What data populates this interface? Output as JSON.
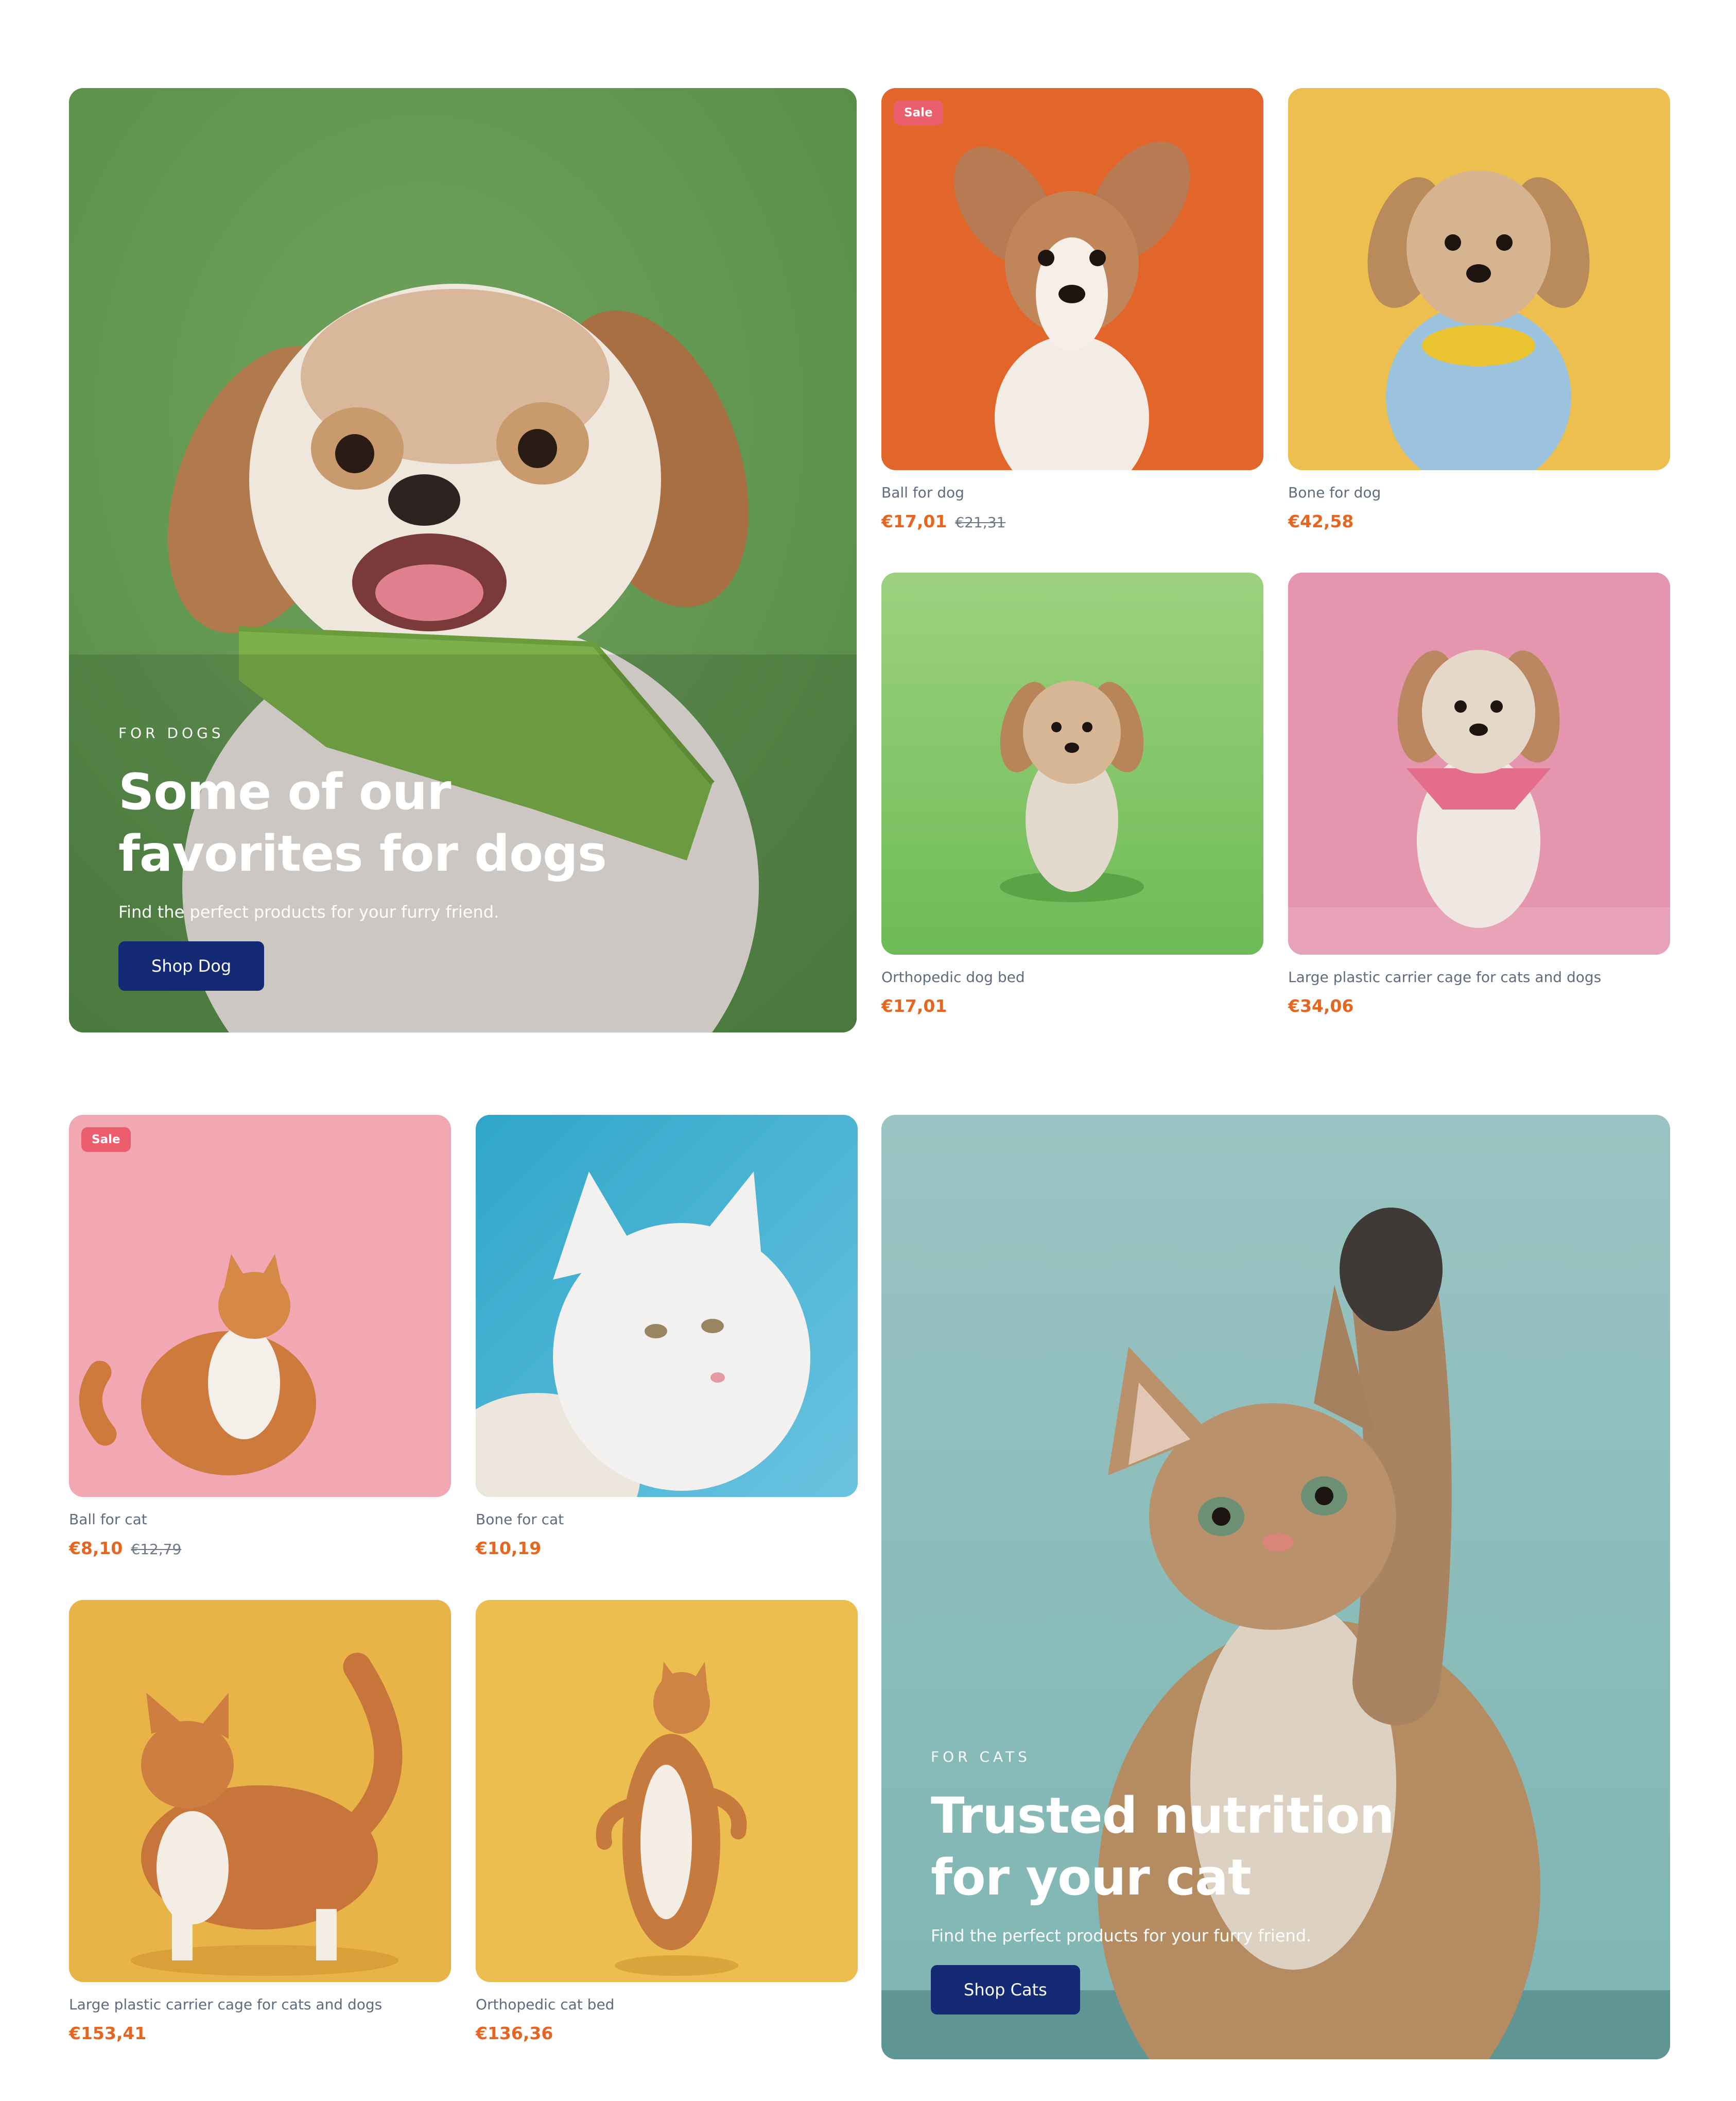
{
  "dogs": {
    "eyebrow": "FOR DOGS",
    "title": "Some of our favorites for dogs",
    "subtitle": "Find the perfect products for your furry friend.",
    "button": "Shop Dog",
    "background": "#5f9650",
    "products": [
      {
        "name": "Ball for dog",
        "price": "€17,01",
        "old_price": "€21,31",
        "sale": "Sale",
        "bg": "#e2652a"
      },
      {
        "name": "Bone for dog",
        "price": "€42,58",
        "bg": "#ecbf4f"
      },
      {
        "name": "Orthopedic dog bed",
        "price": "€17,01",
        "bg": "#8fcb6f"
      },
      {
        "name": "Large plastic carrier cage for cats and dogs",
        "price": "€34,06",
        "bg": "#e595ad"
      }
    ]
  },
  "cats": {
    "eyebrow": "FOR CATS",
    "title": "Trusted nutrition for your cat",
    "subtitle": "Find the perfect products for your furry friend.",
    "button": "Shop Cats",
    "background": "#8fbfbe",
    "products": [
      {
        "name": "Ball for cat",
        "price": "€8,10",
        "old_price": "€12,79",
        "sale": "Sale",
        "bg": "#f1a8b2"
      },
      {
        "name": "Bone for cat",
        "price": "€10,19",
        "bg": "#3fb1d4"
      },
      {
        "name": "Large plastic carrier cage for cats and dogs",
        "price": "€153,41",
        "bg": "#e8b347"
      },
      {
        "name": "Orthopedic cat bed",
        "price": "€136,36",
        "bg": "#ecbe50"
      }
    ]
  },
  "icons": {
    "dog": "dog-photo",
    "cat": "cat-photo"
  }
}
